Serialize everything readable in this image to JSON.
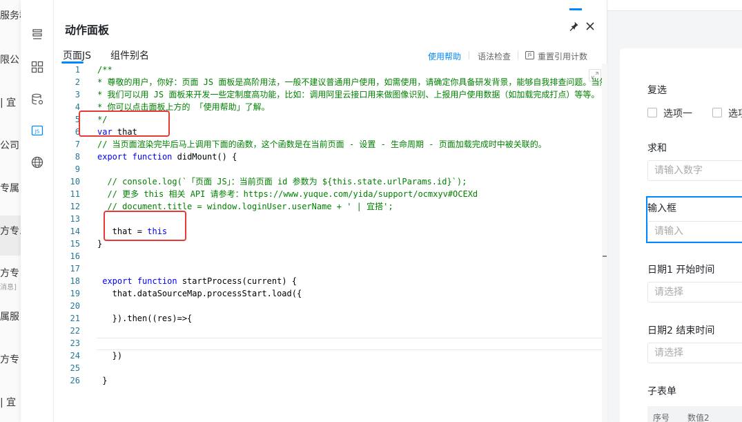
{
  "background_list": {
    "items": [
      "服务群",
      "限公",
      "| 宜",
      "公司",
      "专属",
      "方专.",
      "方专",
      "消息]",
      "属服",
      "方专",
      "| 宜"
    ]
  },
  "panel": {
    "title": "动作面板",
    "tabs": [
      {
        "label": "页面JS",
        "active": true
      },
      {
        "label": "组件别名",
        "active": false
      }
    ],
    "tools": {
      "help": "使用帮助",
      "lint": "语法检查",
      "recount": "重置引用计数",
      "recount_icon_text": "JS"
    },
    "sidebar_icons": [
      "outline-icon",
      "components-icon",
      "datasource-icon",
      "js-icon",
      "globe-icon"
    ],
    "js_icon_text": "JS"
  },
  "code": {
    "lines": [
      {
        "n": "1",
        "parts": [
          {
            "t": "/**",
            "c": "cm"
          }
        ]
      },
      {
        "n": "2",
        "parts": [
          {
            "t": "* 尊敬的用户，你好：页面 JS 面板是高阶用法，一般不建议普通用户使用，如需使用，请确定你具备研发背景，能够自我排查问题。当然",
            "c": "cm"
          }
        ]
      },
      {
        "n": "3",
        "parts": [
          {
            "t": "* 我们可以用 JS 面板来开发一些定制度高功能，比如：调用阿里云接口用来做图像识别、上报用户使用数据（如加载完成打点）等等。",
            "c": "cm"
          }
        ]
      },
      {
        "n": "4",
        "parts": [
          {
            "t": "* 你可以点击面板上方的 「使用帮助」了解。",
            "c": "cm"
          }
        ]
      },
      {
        "n": "5",
        "parts": [
          {
            "t": "*/",
            "c": "cm"
          }
        ]
      },
      {
        "n": "6",
        "parts": [
          {
            "t": "var",
            "c": "kw"
          },
          {
            "t": " that",
            "c": ""
          }
        ]
      },
      {
        "n": "7",
        "parts": [
          {
            "t": "// 当页面渲染完毕后马上调用下面的函数，这个函数是在当前页面 - 设置 - 生命周期 - 页面加载完成时中被关联的。",
            "c": "cm"
          }
        ]
      },
      {
        "n": "8",
        "parts": [
          {
            "t": "export",
            "c": "kw"
          },
          {
            "t": " ",
            "c": ""
          },
          {
            "t": "function",
            "c": "kw"
          },
          {
            "t": " didMount() {",
            "c": ""
          }
        ]
      },
      {
        "n": "9",
        "parts": []
      },
      {
        "n": "10",
        "parts": [
          {
            "t": "  // console.log(`「页面 JS」：当前页面 id 参数为 ${this.state.urlParams.id}`);",
            "c": "cm"
          }
        ]
      },
      {
        "n": "11",
        "parts": [
          {
            "t": "  // 更多 this 相关 API 请参考：https://www.yuque.com/yida/support/ocmxyv#OCEXd",
            "c": "cm"
          }
        ]
      },
      {
        "n": "12",
        "parts": [
          {
            "t": "  // document.title = window.loginUser.userName + ' | 宜搭';",
            "c": "cm"
          }
        ]
      },
      {
        "n": "13",
        "parts": []
      },
      {
        "n": "14",
        "parts": [
          {
            "t": "   that = ",
            "c": ""
          },
          {
            "t": "this",
            "c": "kw"
          }
        ]
      },
      {
        "n": "15",
        "parts": [
          {
            "t": "}",
            "c": ""
          }
        ]
      },
      {
        "n": "16",
        "parts": []
      },
      {
        "n": "17",
        "parts": []
      },
      {
        "n": "18",
        "parts": [
          {
            "t": " export",
            "c": "kw"
          },
          {
            "t": " ",
            "c": ""
          },
          {
            "t": "function",
            "c": "kw"
          },
          {
            "t": " startProcess(current) {",
            "c": ""
          }
        ]
      },
      {
        "n": "19",
        "parts": [
          {
            "t": "   that.dataSourceMap.processStart.load({",
            "c": ""
          }
        ]
      },
      {
        "n": "20",
        "parts": []
      },
      {
        "n": "21",
        "parts": [
          {
            "t": "   }).then((res)=>{",
            "c": ""
          }
        ]
      },
      {
        "n": "22",
        "parts": []
      },
      {
        "n": "23",
        "parts": []
      },
      {
        "n": "24",
        "parts": [
          {
            "t": "   })",
            "c": ""
          }
        ]
      },
      {
        "n": "25",
        "parts": []
      },
      {
        "n": "26",
        "parts": [
          {
            "t": " }",
            "c": ""
          }
        ]
      }
    ]
  },
  "form": {
    "checkbox_title": "复选",
    "option1": "选项一",
    "option2": "选项",
    "sum_label": "求和",
    "sum_placeholder": "请输入数字",
    "input_label": "输入框",
    "input_placeholder": "请输入",
    "date1_label": "日期1 开始时间",
    "date1_placeholder": "请选择",
    "date2_label": "日期2 结束时间",
    "date2_placeholder": "请选择",
    "subform_label": "子表单",
    "subform_col1": "序号",
    "subform_col2": "数值2"
  },
  "colors": {
    "accent": "#0089ff",
    "highlight_box": "#e53935",
    "comment": "#008000",
    "keyword": "#0000ff"
  }
}
